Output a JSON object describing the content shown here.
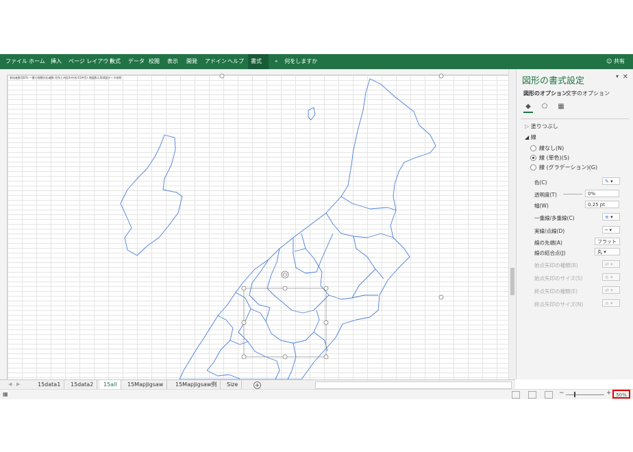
{
  "ribbon": {
    "tabs": [
      "ファイル",
      "ホーム",
      "挿入",
      "ページ レイアウト",
      "数式",
      "データ",
      "校閲",
      "表示",
      "開発",
      "アドイン",
      "ヘルプ",
      "書式"
    ],
    "active_tab": "書式",
    "tell_me": "何をしますか",
    "share": "共有"
  },
  "sheet": {
    "cell_note": "参加者数100% 一番小規模対応者数 住所と市区町村名(15件目) 地図表示用地図データ参照"
  },
  "sheet_tabs": {
    "tabs": [
      "15data1",
      "15data2",
      "15all",
      "15MapJigsaw",
      "15MapJigsaw例",
      "Size"
    ],
    "active": "15all"
  },
  "status": {
    "zoom": "50%"
  },
  "pane": {
    "title": "図形の書式設定",
    "tab_shape": "図形のオプション",
    "tab_text": "文字のオプション",
    "fill_section": "塗りつぶし",
    "line_section": "線",
    "radio_none": "線なし(N)",
    "radio_solid": "線 (単色)(S)",
    "radio_gradient": "線 (グラデーション)(G)",
    "color_label": "色(C)",
    "transparency_label": "透明度(T)",
    "transparency_value": "0%",
    "width_label": "幅(W)",
    "width_value": "0.25 pt",
    "compound_label": "一重線/多重線(C)",
    "dash_label": "実線/点線(D)",
    "cap_label": "線の先端(A)",
    "cap_value": "フラット",
    "join_label": "線の結合点(J)",
    "join_value": "丸",
    "begin_type_label": "始点矢印の種類(B)",
    "begin_size_label": "始点矢印のサイズ(S)",
    "end_type_label": "終点矢印の種類(E)",
    "end_size_label": "終点矢印のサイズ(N)"
  },
  "colors": {
    "ribbon": "#217346",
    "map_line": "#4a7fd8",
    "zoom_highlight": "#e00000"
  }
}
